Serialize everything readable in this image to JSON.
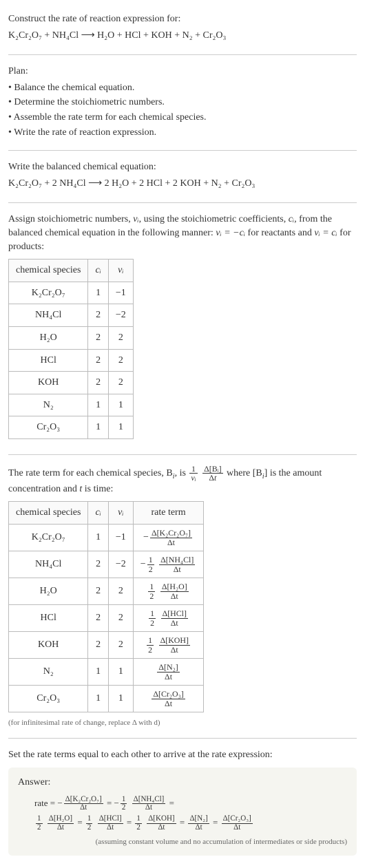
{
  "question": {
    "prompt": "Construct the rate of reaction expression for:",
    "equation": "K₂Cr₂O₇ + NH₄Cl  ⟶  H₂O + HCl + KOH + N₂ + Cr₂O₃"
  },
  "plan": {
    "title": "Plan:",
    "items": [
      "• Balance the chemical equation.",
      "• Determine the stoichiometric numbers.",
      "• Assemble the rate term for each chemical species.",
      "• Write the rate of reaction expression."
    ]
  },
  "balanced": {
    "title": "Write the balanced chemical equation:",
    "equation": "K₂Cr₂O₇ + 2 NH₄Cl  ⟶  2 H₂O + 2 HCl + 2 KOH + N₂ + Cr₂O₃"
  },
  "stoich": {
    "intro_a": "Assign stoichiometric numbers, ",
    "intro_b": ", using the stoichiometric coefficients, ",
    "intro_c": ", from the balanced chemical equation in the following manner: ",
    "intro_d": " for reactants and ",
    "intro_e": " for products:",
    "nu": "νᵢ",
    "ci": "cᵢ",
    "eq_react": "νᵢ = −cᵢ",
    "eq_prod": "νᵢ = cᵢ",
    "headers": [
      "chemical species",
      "cᵢ",
      "νᵢ"
    ],
    "rows": [
      {
        "species": "K₂Cr₂O₇",
        "c": "1",
        "nu": "−1"
      },
      {
        "species": "NH₄Cl",
        "c": "2",
        "nu": "−2"
      },
      {
        "species": "H₂O",
        "c": "2",
        "nu": "2"
      },
      {
        "species": "HCl",
        "c": "2",
        "nu": "2"
      },
      {
        "species": "KOH",
        "c": "2",
        "nu": "2"
      },
      {
        "species": "N₂",
        "c": "1",
        "nu": "1"
      },
      {
        "species": "Cr₂O₃",
        "c": "1",
        "nu": "1"
      }
    ]
  },
  "rateterm": {
    "text_a": "The rate term for each chemical species, B",
    "text_b": ", is ",
    "text_c": " where [B",
    "text_d": "] is the amount concentration and ",
    "text_e": " is time:",
    "t": "t",
    "sub_i": "i",
    "headers": [
      "chemical species",
      "cᵢ",
      "νᵢ",
      "rate term"
    ],
    "rows": [
      {
        "species": "K₂Cr₂O₇",
        "c": "1",
        "nu": "−1",
        "rate_num": "Δ[K₂Cr₂O₇]",
        "rate_den": "Δt",
        "prefix": "−"
      },
      {
        "species": "NH₄Cl",
        "c": "2",
        "nu": "−2",
        "rate_num": "Δ[NH₄Cl]",
        "rate_den": "Δt",
        "prefix": "−½"
      },
      {
        "species": "H₂O",
        "c": "2",
        "nu": "2",
        "rate_num": "Δ[H₂O]",
        "rate_den": "Δt",
        "prefix": "½"
      },
      {
        "species": "HCl",
        "c": "2",
        "nu": "2",
        "rate_num": "Δ[HCl]",
        "rate_den": "Δt",
        "prefix": "½"
      },
      {
        "species": "KOH",
        "c": "2",
        "nu": "2",
        "rate_num": "Δ[KOH]",
        "rate_den": "Δt",
        "prefix": "½"
      },
      {
        "species": "N₂",
        "c": "1",
        "nu": "1",
        "rate_num": "Δ[N₂]",
        "rate_den": "Δt",
        "prefix": ""
      },
      {
        "species": "Cr₂O₃",
        "c": "1",
        "nu": "1",
        "rate_num": "Δ[Cr₂O₃]",
        "rate_den": "Δt",
        "prefix": ""
      }
    ],
    "note": "(for infinitesimal rate of change, replace Δ with d)"
  },
  "setequal": {
    "text": "Set the rate terms equal to each other to arrive at the rate expression:"
  },
  "answer": {
    "label": "Answer:",
    "rate_prefix": "rate = ",
    "terms": [
      {
        "prefix": "−",
        "num": "Δ[K₂Cr₂O₇]",
        "den": "Δt"
      },
      {
        "prefix": "−½",
        "num": "Δ[NH₄Cl]",
        "den": "Δt"
      },
      {
        "prefix": "½",
        "num": "Δ[H₂O]",
        "den": "Δt"
      },
      {
        "prefix": "½",
        "num": "Δ[HCl]",
        "den": "Δt"
      },
      {
        "prefix": "½",
        "num": "Δ[KOH]",
        "den": "Δt"
      },
      {
        "prefix": "",
        "num": "Δ[N₂]",
        "den": "Δt"
      },
      {
        "prefix": "",
        "num": "Δ[Cr₂O₃]",
        "den": "Δt"
      }
    ],
    "eq": " = ",
    "note": "(assuming constant volume and no accumulation of intermediates or side products)"
  }
}
